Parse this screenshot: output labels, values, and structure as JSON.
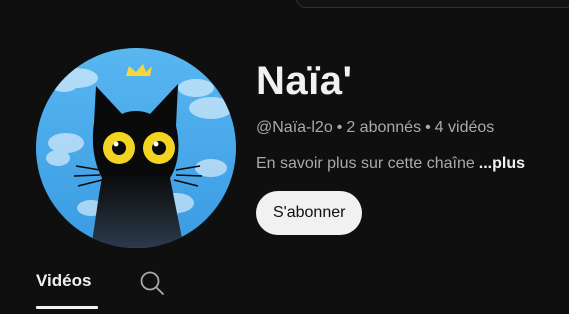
{
  "channel": {
    "name": "Naïa'",
    "handle": "@Naïa-l2o",
    "subscribers": "2 abonnés",
    "videos_count": "4 vidéos",
    "separator": "•",
    "about_text": "En savoir plus sur cette chaîne",
    "about_more": "...plus",
    "subscribe_label": "S'abonner",
    "avatar_icon": "black-cat-with-crown-avatar"
  },
  "tabs": [
    {
      "label": "Vidéos",
      "active": true
    },
    {
      "icon": "search-icon"
    }
  ],
  "colors": {
    "background": "#0f0f0f",
    "primary_text": "#f1f1f1",
    "secondary_text": "#aaaaaa",
    "button_bg": "#f1f1f1",
    "sky": "#3fa2e8",
    "crown": "#f5d63b",
    "cat_eyes": "#f2d421"
  }
}
